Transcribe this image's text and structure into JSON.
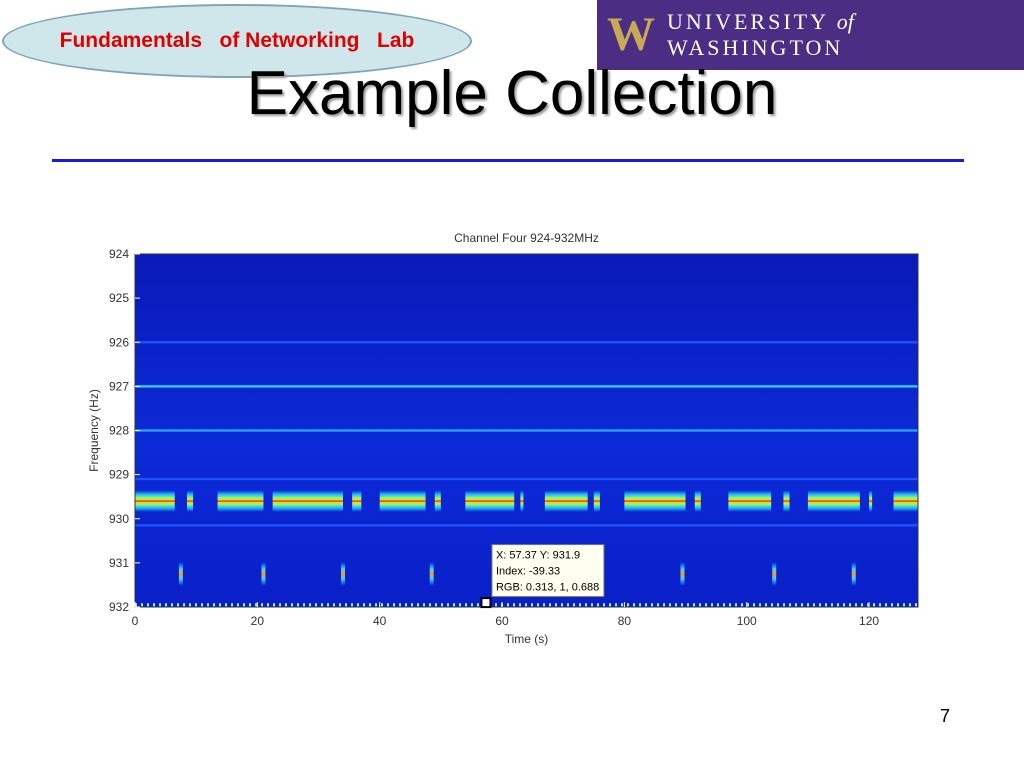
{
  "badge": {
    "text": "Fundamentals   of Networking   Lab"
  },
  "logo": {
    "mark": "W",
    "university": "UNIVERSITY",
    "of": "of",
    "washington": "WASHINGTON",
    "bg_color": "#4b2e83",
    "mark_color": "#c8a955"
  },
  "slide": {
    "title": "Example Collection",
    "page_number": "7"
  },
  "chart_data": {
    "type": "heatmap",
    "title": "Channel Four 924-932MHz",
    "xlabel": "Time (s)",
    "ylabel": "Frequency (Hz)",
    "xlim": [
      0,
      128
    ],
    "ylim": [
      924,
      932
    ],
    "y_reversed": true,
    "x_ticks": [
      0,
      20,
      40,
      60,
      80,
      100,
      120
    ],
    "y_ticks": [
      924,
      925,
      926,
      927,
      928,
      929,
      930,
      931,
      932
    ],
    "colormap": "jet",
    "background_color": "#0a1fc8",
    "steady_lines": [
      {
        "freq": 926.0,
        "color": "#1f55ff"
      },
      {
        "freq": 927.0,
        "color": "#31d7ff"
      },
      {
        "freq": 928.0,
        "color": "#2aa6ff"
      },
      {
        "freq": 929.1,
        "color": "#1f55ff"
      },
      {
        "freq": 930.15,
        "color": "#1f55ff"
      }
    ],
    "main_band": {
      "freq": 929.6,
      "segments": [
        [
          0,
          6.5
        ],
        [
          8.5,
          9.5
        ],
        [
          13.5,
          21
        ],
        [
          22.5,
          34
        ],
        [
          35.5,
          37
        ],
        [
          40,
          47.5
        ],
        [
          49,
          50
        ],
        [
          54,
          62
        ],
        [
          63,
          63.5
        ],
        [
          67,
          74
        ],
        [
          75,
          76
        ],
        [
          80,
          90
        ],
        [
          91.5,
          92.5
        ],
        [
          97,
          104
        ],
        [
          106,
          107
        ],
        [
          110,
          118.5
        ],
        [
          120,
          120.5
        ],
        [
          124,
          128
        ]
      ]
    },
    "bursts": [
      7.5,
      21,
      34,
      48.5,
      89.5,
      104.5,
      117.5
    ],
    "dotted_line": {
      "freq": 931.95
    },
    "datatip": {
      "x": 57.37,
      "y": 931.9,
      "line1": "X: 57.37 Y: 931.9",
      "line2": "Index: -39.33",
      "line3": "RGB: 0.313, 1, 0.688"
    }
  }
}
